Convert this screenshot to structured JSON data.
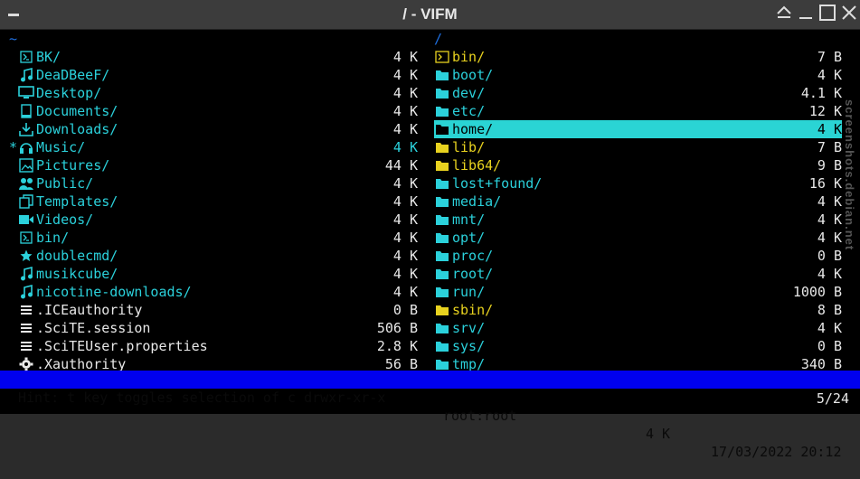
{
  "window": {
    "title": "/ - VIFM"
  },
  "left_pane": {
    "path": "~",
    "entries": [
      {
        "icon": "terminal-icon",
        "name": "BK/",
        "size": "4 K",
        "color": "cyan"
      },
      {
        "icon": "music-note-icon",
        "name": "DeaDBeeF/",
        "size": "4 K",
        "color": "cyan"
      },
      {
        "icon": "monitor-icon",
        "name": "Desktop/",
        "size": "4 K",
        "color": "cyan"
      },
      {
        "icon": "document-icon",
        "name": "Documents/",
        "size": "4 K",
        "color": "cyan"
      },
      {
        "icon": "download-icon",
        "name": "Downloads/",
        "size": "4 K",
        "color": "cyan"
      },
      {
        "icon": "headphones-icon",
        "name": "Music/",
        "size": "4 K",
        "color": "cyan",
        "marked": "*"
      },
      {
        "icon": "image-icon",
        "name": "Pictures/",
        "size": "44 K",
        "color": "cyan"
      },
      {
        "icon": "users-icon",
        "name": "Public/",
        "size": "4 K",
        "color": "cyan"
      },
      {
        "icon": "copy-icon",
        "name": "Templates/",
        "size": "4 K",
        "color": "cyan"
      },
      {
        "icon": "video-camera-icon",
        "name": "Videos/",
        "size": "4 K",
        "color": "cyan"
      },
      {
        "icon": "terminal-icon",
        "name": "bin/",
        "size": "4 K",
        "color": "cyan"
      },
      {
        "icon": "star-icon",
        "name": "doublecmd/",
        "size": "4 K",
        "color": "cyan"
      },
      {
        "icon": "music-note-icon",
        "name": "musikcube/",
        "size": "4 K",
        "color": "cyan"
      },
      {
        "icon": "music-note-icon",
        "name": "nicotine-downloads/",
        "size": "4 K",
        "color": "cyan"
      },
      {
        "icon": "lines-icon",
        "name": ".ICEauthority",
        "size": "0 B",
        "color": "white"
      },
      {
        "icon": "lines-icon",
        "name": ".SciTE.session",
        "size": "506 B",
        "color": "white"
      },
      {
        "icon": "lines-icon",
        "name": ".SciTEUser.properties",
        "size": "2.8 K",
        "color": "white"
      },
      {
        "icon": "gear-icon",
        "name": ".Xauthority",
        "size": "56 B",
        "color": "white"
      }
    ]
  },
  "right_pane": {
    "path": "/",
    "entries": [
      {
        "icon": "terminal-folder-icon",
        "name": "bin/",
        "size": "7 B",
        "color": "yellow"
      },
      {
        "icon": "folder-icon",
        "name": "boot/",
        "size": "4 K",
        "color": "cyan"
      },
      {
        "icon": "folder-icon",
        "name": "dev/",
        "size": "4.1 K",
        "color": "cyan"
      },
      {
        "icon": "folder-icon",
        "name": "etc/",
        "size": "12 K",
        "color": "cyan"
      },
      {
        "icon": "folder-icon",
        "name": "home/",
        "size": "4 K",
        "color": "cyan",
        "selected": true
      },
      {
        "icon": "folder-icon",
        "name": "lib/",
        "size": "7 B",
        "color": "yellow"
      },
      {
        "icon": "folder-icon",
        "name": "lib64/",
        "size": "9 B",
        "color": "yellow"
      },
      {
        "icon": "folder-icon",
        "name": "lost+found/",
        "size": "16 K",
        "color": "cyan"
      },
      {
        "icon": "folder-icon",
        "name": "media/",
        "size": "4 K",
        "color": "cyan"
      },
      {
        "icon": "folder-icon",
        "name": "mnt/",
        "size": "4 K",
        "color": "cyan"
      },
      {
        "icon": "folder-icon",
        "name": "opt/",
        "size": "4 K",
        "color": "cyan"
      },
      {
        "icon": "folder-icon",
        "name": "proc/",
        "size": "0 B",
        "color": "cyan"
      },
      {
        "icon": "folder-icon",
        "name": "root/",
        "size": "4 K",
        "color": "cyan"
      },
      {
        "icon": "folder-icon",
        "name": "run/",
        "size": "1000 B",
        "color": "cyan"
      },
      {
        "icon": "folder-icon",
        "name": "sbin/",
        "size": "8 B",
        "color": "yellow"
      },
      {
        "icon": "folder-icon",
        "name": "srv/",
        "size": "4 K",
        "color": "cyan"
      },
      {
        "icon": "folder-icon",
        "name": "sys/",
        "size": "0 B",
        "color": "cyan"
      },
      {
        "icon": "folder-icon",
        "name": "tmp/",
        "size": "340 B",
        "color": "cyan"
      }
    ]
  },
  "status": {
    "hint": "Hint: t key toggles selection of c drwxr-xr-x",
    "owner": "root:root",
    "size": "4 K",
    "datetime": "17/03/2022 20:12"
  },
  "position": "5/24",
  "watermark": "screenshots.debian.net",
  "colors": {
    "cyan": "#2bd1db",
    "yellow": "#e8d21f",
    "white": "#e8e8e8",
    "path_blue": "#1e6fe0",
    "status_bg": "#0000ee",
    "selection_bg": "#2ad4d4"
  }
}
